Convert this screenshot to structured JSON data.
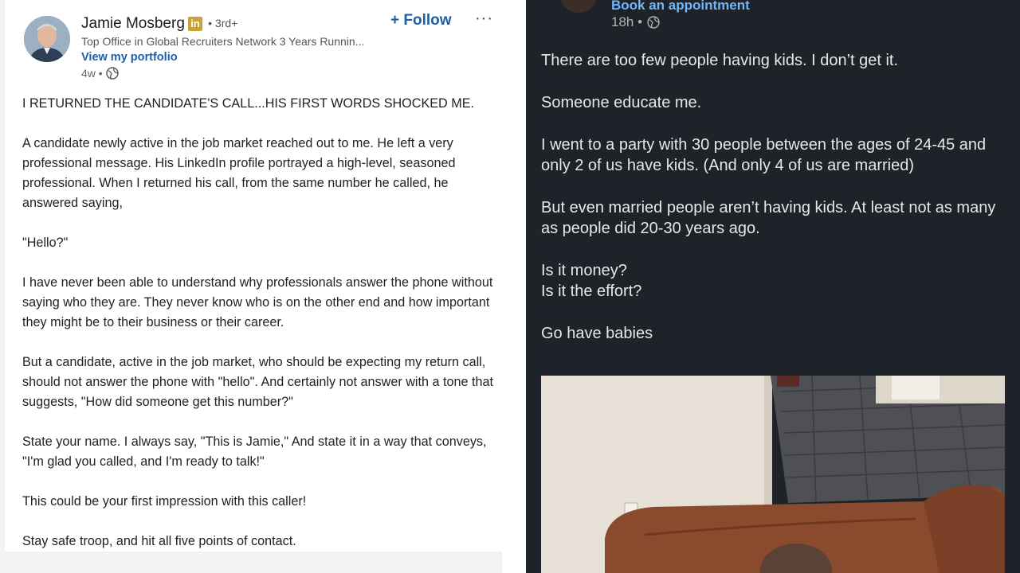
{
  "linkedin_post": {
    "author_name": "Jamie Mosberg",
    "author_badge": "in",
    "connection_degree": "• 3rd+",
    "headline": "Top Office in Global Recruiters Network 3 Years Runnin...",
    "portfolio_link": "View my portfolio",
    "timestamp": "4w •",
    "follow_label": "+ Follow",
    "more_label": "···",
    "paragraphs": [
      "I RETURNED THE CANDIDATE'S CALL...HIS FIRST WORDS SHOCKED ME.",
      "A candidate newly active in the job market reached out to me. He left a very professional message. His LinkedIn profile portrayed a high-level, seasoned professional. When I returned his call, from the same number he called, he answered saying,",
      "\"Hello?\"",
      "I have never been able to understand why professionals answer the phone without saying who they are. They never know who is on the other end and how important they might be to their business or their career.",
      "But a candidate, active in the job market, who should be expecting my return call, should not answer the phone with \"hello\". And certainly not answer with a tone that suggests, \"How did someone get this number?\"",
      "State your name. I always say, \"This is Jamie,\" And state it in a way that conveys, \"I'm glad you called, and I'm ready to talk!\"",
      "This could be your first impression with this caller!",
      "Stay safe troop, and hit all five points of contact."
    ]
  },
  "dark_post": {
    "link": "Book an appointment",
    "timestamp": "18h •",
    "paragraphs": [
      [
        "There are too few people having kids. I don’t get it."
      ],
      [
        "Someone educate me."
      ],
      [
        "I went to a party with 30 people between the ages of 24-45 and only 2 of us have kids. (And only 4 of us are married)"
      ],
      [
        "But even married people aren’t having kids. At least not as many as people did 20-30 years ago."
      ],
      [
        "Is it money?",
        "Is it the effort?"
      ],
      [
        "Go have babies"
      ]
    ]
  },
  "colors": {
    "link_blue": "#1d5fa8",
    "dark_bg": "#1e2329",
    "dark_link": "#71b7fb",
    "dark_text": "#e7e7e7"
  }
}
